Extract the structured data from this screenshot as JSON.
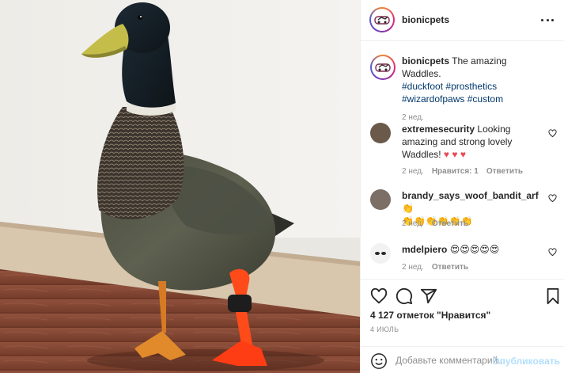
{
  "post": {
    "username": "bionicpets",
    "caption_text": "The amazing Waddles.",
    "hashtags_line1": [
      "#duckfoot",
      "#prosthetics"
    ],
    "hashtags_line2": [
      "#wizardofpaws",
      "#custom"
    ],
    "caption_time": "2 нед."
  },
  "comments": [
    {
      "username": "extremesecurity",
      "text": "Looking amazing and strong lovely Waddles!",
      "emoji": "♥ ♥ ♥",
      "time": "2 нед.",
      "likes": "Нравится: 1",
      "reply": "Ответить"
    },
    {
      "username": "brandy_says_woof_bandit_arf",
      "emoji_inline": "👏",
      "emoji_line2": "👏👏👏👏👏👏",
      "time": "2 нед.",
      "reply": "Ответить"
    },
    {
      "username": "mdelpiero",
      "emoji": "😍😍😍😍😍",
      "time": "2 нед.",
      "reply": "Ответить"
    }
  ],
  "actions": {
    "likes_text": "4 127 отметок \"Нравится\"",
    "date": "4 ИЮЛЬ",
    "comment_placeholder": "Добавьте комментарий...",
    "publish_label": "Опубликовать",
    "icons": [
      "heart-icon",
      "comment-icon",
      "share-icon",
      "bookmark-icon",
      "emoji-icon"
    ]
  },
  "colors": {
    "accent_link": "#00376b",
    "publish_disabled": "#b2dffc",
    "like_red": "#ed4956",
    "meta_grey": "#8e8e8e"
  }
}
